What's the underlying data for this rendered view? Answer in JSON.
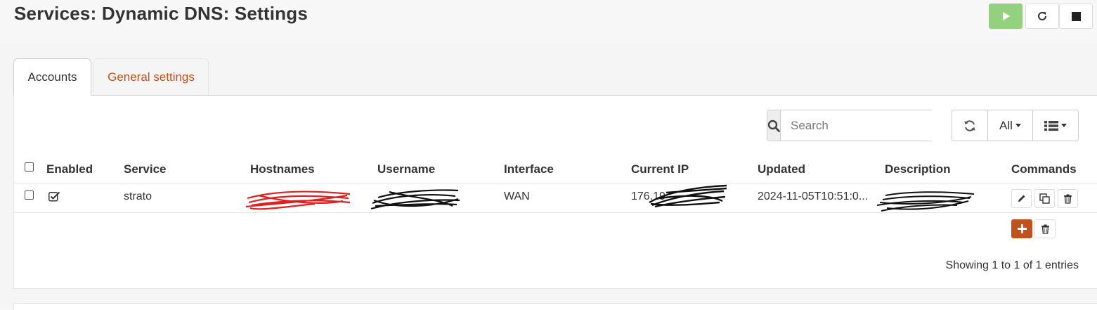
{
  "page": {
    "title": "Services: Dynamic DNS: Settings"
  },
  "service_controls": [
    {
      "name": "start",
      "icon": "play-icon",
      "color": "#93d17e"
    },
    {
      "name": "restart",
      "icon": "restart-icon"
    },
    {
      "name": "stop",
      "icon": "stop-icon"
    }
  ],
  "tabs": [
    {
      "label": "Accounts",
      "active": true
    },
    {
      "label": "General settings",
      "active": false,
      "color": "#c2501a"
    }
  ],
  "toolbar": {
    "search_placeholder": "Search",
    "row_count_label": "All"
  },
  "table": {
    "columns": [
      "Enabled",
      "Service",
      "Hostnames",
      "Username",
      "Interface",
      "Current IP",
      "Updated",
      "Description",
      "Commands"
    ],
    "rows": [
      {
        "enabled": true,
        "service": "strato",
        "interface": "WAN",
        "current_ip": "176.19",
        "updated": "2024-11-05T10:51:0..."
      }
    ]
  },
  "footer": {
    "info": "Showing 1 to 1 of 1 entries"
  },
  "colors": {
    "accent": "#c0531d",
    "start_button": "#93d17e"
  }
}
